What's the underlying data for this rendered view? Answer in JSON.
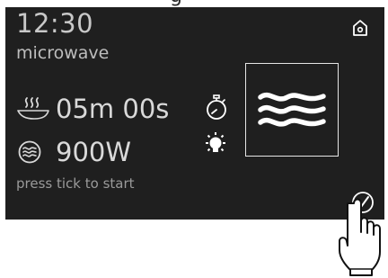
{
  "top_text": "g",
  "status": {
    "time": "12:30",
    "mode": "microwave"
  },
  "cooking": {
    "duration": "05m 00s",
    "power": "900W",
    "hint": "press tick to start"
  },
  "icons": {
    "home": "home-icon",
    "duration": "cooking-duration-icon",
    "power": "microwave-power-icon",
    "timer": "stopwatch-icon",
    "light": "light-bulb-icon",
    "mode": "microwave-waves-icon",
    "start": "tick-icon",
    "pointer": "hand-pointer-icon"
  },
  "colors": {
    "screen_bg": "#1f1f1f",
    "text_primary": "#d9d9d9",
    "text_secondary": "#9a9a9a",
    "icon": "#ffffff"
  }
}
